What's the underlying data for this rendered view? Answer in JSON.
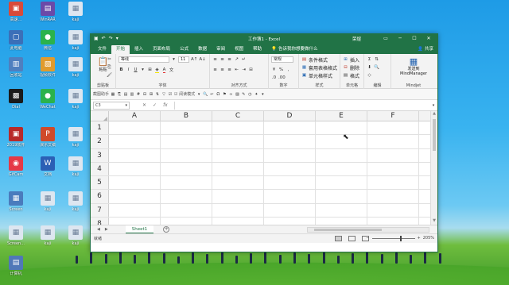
{
  "desktop": {
    "icons": [
      {
        "label": "高速...",
        "color": "#d84a3a",
        "glyph": "▣"
      },
      {
        "label": "WinRAR",
        "color": "#6b4aa8",
        "glyph": "▤"
      },
      {
        "label": "kaji",
        "color": "#dde6f0",
        "glyph": "▦"
      },
      {
        "label": "此电脑",
        "color": "#3b6fb8",
        "glyph": "▢"
      },
      {
        "label": "微信",
        "color": "#2bb24c",
        "glyph": "●"
      },
      {
        "label": "kaji",
        "color": "#dde6f0",
        "glyph": "▦"
      },
      {
        "label": "回收站",
        "color": "#4f7fbf",
        "glyph": "▥"
      },
      {
        "label": "视频软件",
        "color": "#e09b2d",
        "glyph": "▧"
      },
      {
        "label": "kaji",
        "color": "#dde6f0",
        "glyph": "▦"
      },
      {
        "label": "Dial",
        "color": "#1a1a1a",
        "glyph": "▩"
      },
      {
        "label": "WeChat",
        "color": "#2bb24c",
        "glyph": "●"
      },
      {
        "label": "kaji",
        "color": "#dde6f0",
        "glyph": "▦"
      },
      {
        "label": "2019软件",
        "color": "#b82a2a",
        "glyph": "▣"
      },
      {
        "label": "演示文稿",
        "color": "#d04a2a",
        "glyph": "P"
      },
      {
        "label": "kaji",
        "color": "#dde6f0",
        "glyph": "▦"
      },
      {
        "label": "GifCam",
        "color": "#e53946",
        "glyph": "◉"
      },
      {
        "label": "文档",
        "color": "#2b5fb5",
        "glyph": "W"
      },
      {
        "label": "kaji",
        "color": "#dde6f0",
        "glyph": "▦"
      },
      {
        "label": "Screen",
        "color": "#4a7bbd",
        "glyph": "▦"
      },
      {
        "label": "kaji",
        "color": "#dde6f0",
        "glyph": "▦"
      },
      {
        "label": "kaji",
        "color": "#dde6f0",
        "glyph": "▦"
      },
      {
        "label": "Screen...",
        "color": "#dde6f0",
        "glyph": "▦"
      },
      {
        "label": "kaji",
        "color": "#dde6f0",
        "glyph": "▦"
      },
      {
        "label": "kaji",
        "color": "#dde6f0",
        "glyph": "▦"
      },
      {
        "label": "计算机",
        "color": "#5078b8",
        "glyph": "▤"
      }
    ]
  },
  "window": {
    "title": "工作簿1 - Excel",
    "user": "荣煜",
    "share_label": "共享",
    "tell_me_placeholder": "告诉我你想要做什么"
  },
  "tabs": [
    "文件",
    "开始",
    "插入",
    "页面布局",
    "公式",
    "数据",
    "审阅",
    "视图",
    "帮助"
  ],
  "active_tab": "开始",
  "ribbon": {
    "clipboard": {
      "name": "剪贴板",
      "paste": "粘贴"
    },
    "font": {
      "name": "字体",
      "font_family": "等线",
      "font_size": "11",
      "bold": "B",
      "italic": "I",
      "underline": "U"
    },
    "alignment": {
      "name": "对齐方式"
    },
    "number": {
      "name": "数字",
      "format": "常规"
    },
    "styles": {
      "name": "样式",
      "items": [
        "条件格式",
        "套用表格格式",
        "单元格样式"
      ]
    },
    "cells": {
      "name": "单元格",
      "items": [
        "插入",
        "删除",
        "格式"
      ]
    },
    "editing": {
      "name": "编辑"
    },
    "mindjet": {
      "name": "Mindjet",
      "button": "发送到 MindManager"
    }
  },
  "toolbar2": {
    "label": "截图助手",
    "checkbox_label": "阅读模式"
  },
  "formula_bar": {
    "name_box": "C3",
    "cancel": "✕",
    "enter": "✓",
    "fx": "fx",
    "value": ""
  },
  "grid": {
    "columns": [
      "A",
      "B",
      "C",
      "D",
      "E",
      "F"
    ],
    "rows": [
      "1",
      "2",
      "3",
      "4",
      "5",
      "6",
      "7",
      "8"
    ]
  },
  "sheets": {
    "tabs": [
      "Sheet1"
    ],
    "add_label": "+"
  },
  "status": {
    "text": "就绪",
    "zoom": "205%"
  }
}
